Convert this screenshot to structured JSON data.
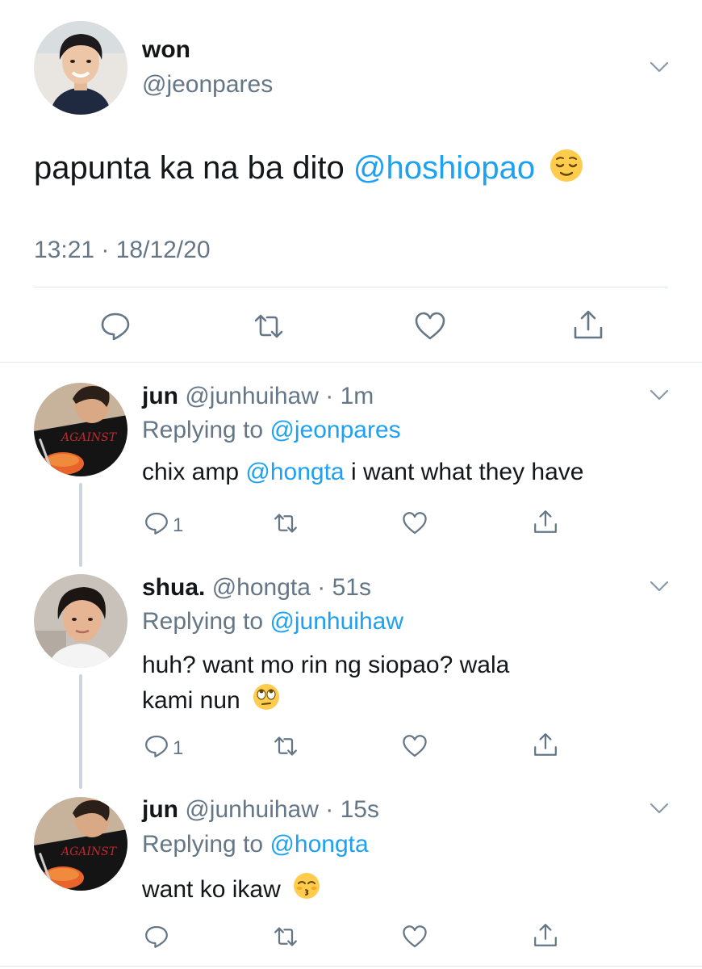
{
  "main_tweet": {
    "name": "won",
    "handle": "@jeonpares",
    "text_prefix": "papunta ka na ba dito",
    "mention": "@hoshiopao",
    "emoji": "relieved-face",
    "timestamp": "13:21 · 18/12/20"
  },
  "replies": [
    {
      "name": "jun",
      "handle": "@junhuihaw",
      "age": "1m",
      "replying_prefix": "Replying to",
      "replying_to": "@jeonpares",
      "text_prefix": "chix amp",
      "mention": "@hongta",
      "text_suffix": "i want what they have",
      "reply_count": "1"
    },
    {
      "name": "shua.",
      "handle": "@hongta",
      "age": "51s",
      "replying_prefix": "Replying to",
      "replying_to": "@junhuihaw",
      "text_line1": "huh? want mo rin ng siopao? wala",
      "text_line2": "kami nun",
      "emoji": "face-with-rolling-eyes",
      "reply_count": "1"
    },
    {
      "name": "jun",
      "handle": "@junhuihaw",
      "age": "15s",
      "replying_prefix": "Replying to",
      "replying_to": "@hongta",
      "text": "want ko ikaw",
      "emoji": "kissing-face-with-closed-eyes",
      "reply_count": ""
    }
  ],
  "colors": {
    "link": "#1da1f2",
    "secondary_text": "#657786",
    "divider": "#e1e8ed",
    "thread_line": "#ccd6dd"
  }
}
